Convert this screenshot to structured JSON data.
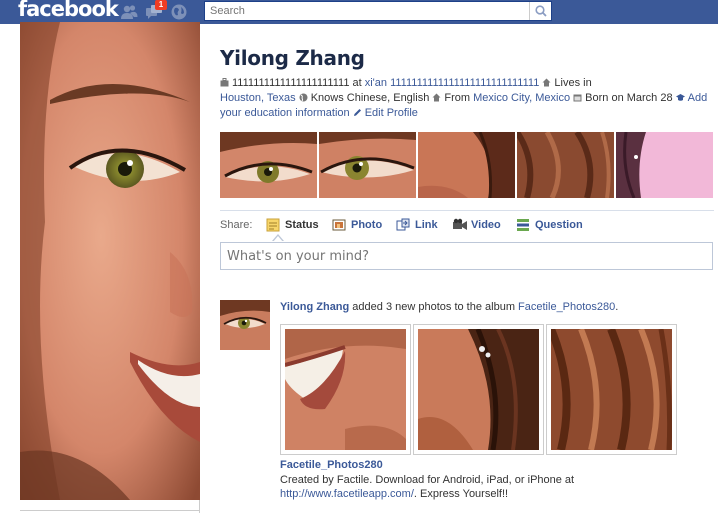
{
  "topbar": {
    "logo": "facebook",
    "messages_badge": "1",
    "search_placeholder": "Search"
  },
  "profile": {
    "name": "Yilong Zhang",
    "work_left": "1111111111111111111111 at ",
    "work_link": "xi'an 1111111111111111111111111111",
    "lives_label": "Lives in",
    "lives_link": "Houston, Texas",
    "knows": "Knows Chinese, English",
    "from_label": "From ",
    "from_link": "Mexico City, Mexico",
    "born_label": "Born on March 28",
    "add_education": "Add your education information",
    "edit_profile": "Edit Profile"
  },
  "share": {
    "label": "Share:",
    "status": "Status",
    "photo": "Photo",
    "link": "Link",
    "video": "Video",
    "question": "Question",
    "input_placeholder": "What's on your mind?"
  },
  "story": {
    "actor": "Yilong Zhang",
    "action": " added 3 new photos to the album ",
    "album_link": "Facetile_Photos280",
    "end": ".",
    "album_title": "Facetile_Photos280",
    "desc_line1": "Created by Factile. Download for Android, iPad, or iPhone at",
    "desc_url": "http://www.facetileapp.com/",
    "desc_line2_end": ". Express Yourself!!"
  },
  "colors": {
    "brand": "#3b5998",
    "link": "#3b5998",
    "badge": "#f03d25"
  }
}
